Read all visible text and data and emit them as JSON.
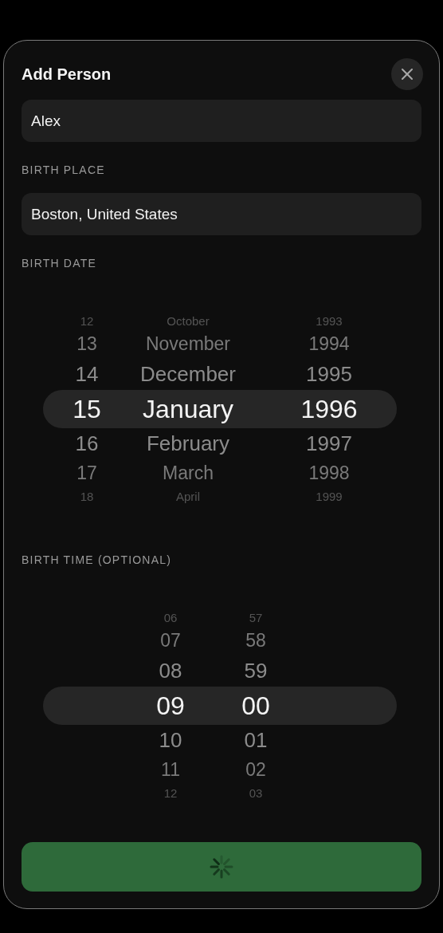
{
  "dialog": {
    "title": "Add Person"
  },
  "name_field": {
    "value": "Alex"
  },
  "birth_place": {
    "label": "BIRTH PLACE",
    "value": "Boston, United States"
  },
  "birth_date": {
    "label": "BIRTH DATE",
    "columns": [
      {
        "kind": "day",
        "rows": [
          {
            "text": "12",
            "selected": false
          },
          {
            "text": "13",
            "selected": false
          },
          {
            "text": "14",
            "selected": false
          },
          {
            "text": "15",
            "selected": true
          },
          {
            "text": "16",
            "selected": false
          },
          {
            "text": "17",
            "selected": false
          },
          {
            "text": "18",
            "selected": false
          }
        ]
      },
      {
        "kind": "month",
        "rows": [
          {
            "text": "October",
            "selected": false
          },
          {
            "text": "November",
            "selected": false
          },
          {
            "text": "December",
            "selected": false
          },
          {
            "text": "January",
            "selected": true
          },
          {
            "text": "February",
            "selected": false
          },
          {
            "text": "March",
            "selected": false
          },
          {
            "text": "April",
            "selected": false
          }
        ]
      },
      {
        "kind": "year",
        "rows": [
          {
            "text": "1993",
            "selected": false
          },
          {
            "text": "1994",
            "selected": false
          },
          {
            "text": "1995",
            "selected": false
          },
          {
            "text": "1996",
            "selected": true
          },
          {
            "text": "1997",
            "selected": false
          },
          {
            "text": "1998",
            "selected": false
          },
          {
            "text": "1999",
            "selected": false
          }
        ]
      }
    ]
  },
  "birth_time": {
    "label": "BIRTH TIME (OPTIONAL)",
    "columns": [
      {
        "kind": "hour",
        "rows": [
          {
            "text": "06",
            "selected": false
          },
          {
            "text": "07",
            "selected": false
          },
          {
            "text": "08",
            "selected": false
          },
          {
            "text": "09",
            "selected": true
          },
          {
            "text": "10",
            "selected": false
          },
          {
            "text": "11",
            "selected": false
          },
          {
            "text": "12",
            "selected": false
          }
        ]
      },
      {
        "kind": "minute",
        "rows": [
          {
            "text": "57",
            "selected": false
          },
          {
            "text": "58",
            "selected": false
          },
          {
            "text": "59",
            "selected": false
          },
          {
            "text": "00",
            "selected": true
          },
          {
            "text": "01",
            "selected": false
          },
          {
            "text": "02",
            "selected": false
          },
          {
            "text": "03",
            "selected": false
          }
        ]
      }
    ]
  },
  "submit_button": {
    "loading": true
  }
}
